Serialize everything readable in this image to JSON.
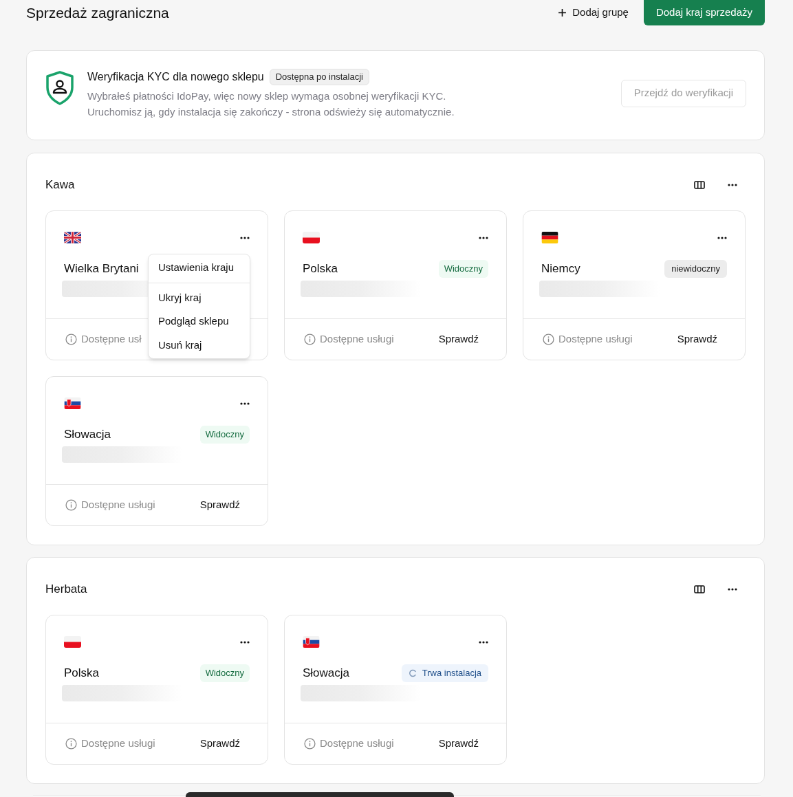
{
  "header": {
    "title": "Sprzedaż zagraniczna",
    "add_group": "Dodaj grupę",
    "add_country": "Dodaj kraj sprzedaży"
  },
  "kyc": {
    "title": "Weryfikacja KYC dla nowego sklepu",
    "badge": "Dostępna po instalacji",
    "lines": [
      "Wybrałeś płatności IdoPay, więc nowy sklep wymaga osobnej weryfikacji KYC.",
      "Uruchomisz ją, gdy instalacja się zakończy - strona odświeży się automatycznie."
    ],
    "button": "Przejdź do weryfikacji"
  },
  "groups": [
    {
      "name": "Kawa",
      "countries": [
        {
          "kind": "gb",
          "name": "Wielka Brytani",
          "services": "Dostępne usł",
          "menu_open": true
        },
        {
          "kind": "pl",
          "name": "Polska",
          "status": {
            "kind": "visible",
            "label": "Widoczny"
          },
          "services": "Dostępne usługi",
          "check": "Sprawdź",
          "menu_open": false
        },
        {
          "kind": "de",
          "name": "Niemcy",
          "status": {
            "kind": "hidden",
            "label": "niewidoczny"
          },
          "services": "Dostępne usługi",
          "check": "Sprawdź",
          "menu_open": false
        },
        {
          "kind": "sk",
          "name": "Słowacja",
          "status": {
            "kind": "visible",
            "label": "Widoczny"
          },
          "services": "Dostępne usługi",
          "check": "Sprawdź",
          "menu_open": false
        }
      ]
    },
    {
      "name": "Herbata",
      "countries": [
        {
          "kind": "pl",
          "name": "Polska",
          "status": {
            "kind": "visible",
            "label": "Widoczny"
          },
          "services": "Dostępne usługi",
          "check": "Sprawdź",
          "menu_open": false
        },
        {
          "kind": "sk",
          "name": "Słowacja",
          "status": {
            "kind": "installing",
            "label": "Trwa instalacja"
          },
          "services": "Dostępne usługi",
          "check": "Sprawdź",
          "menu_open": false
        }
      ]
    }
  ],
  "country_menu": {
    "items": [
      {
        "label": "Ustawienia kraju",
        "divider_after": true
      },
      {
        "label": "Ukryj kraj",
        "divider_after": false
      },
      {
        "label": "Podgląd sklepu",
        "divider_after": false
      },
      {
        "label": "Usuń kraj",
        "divider_after": false
      }
    ]
  }
}
